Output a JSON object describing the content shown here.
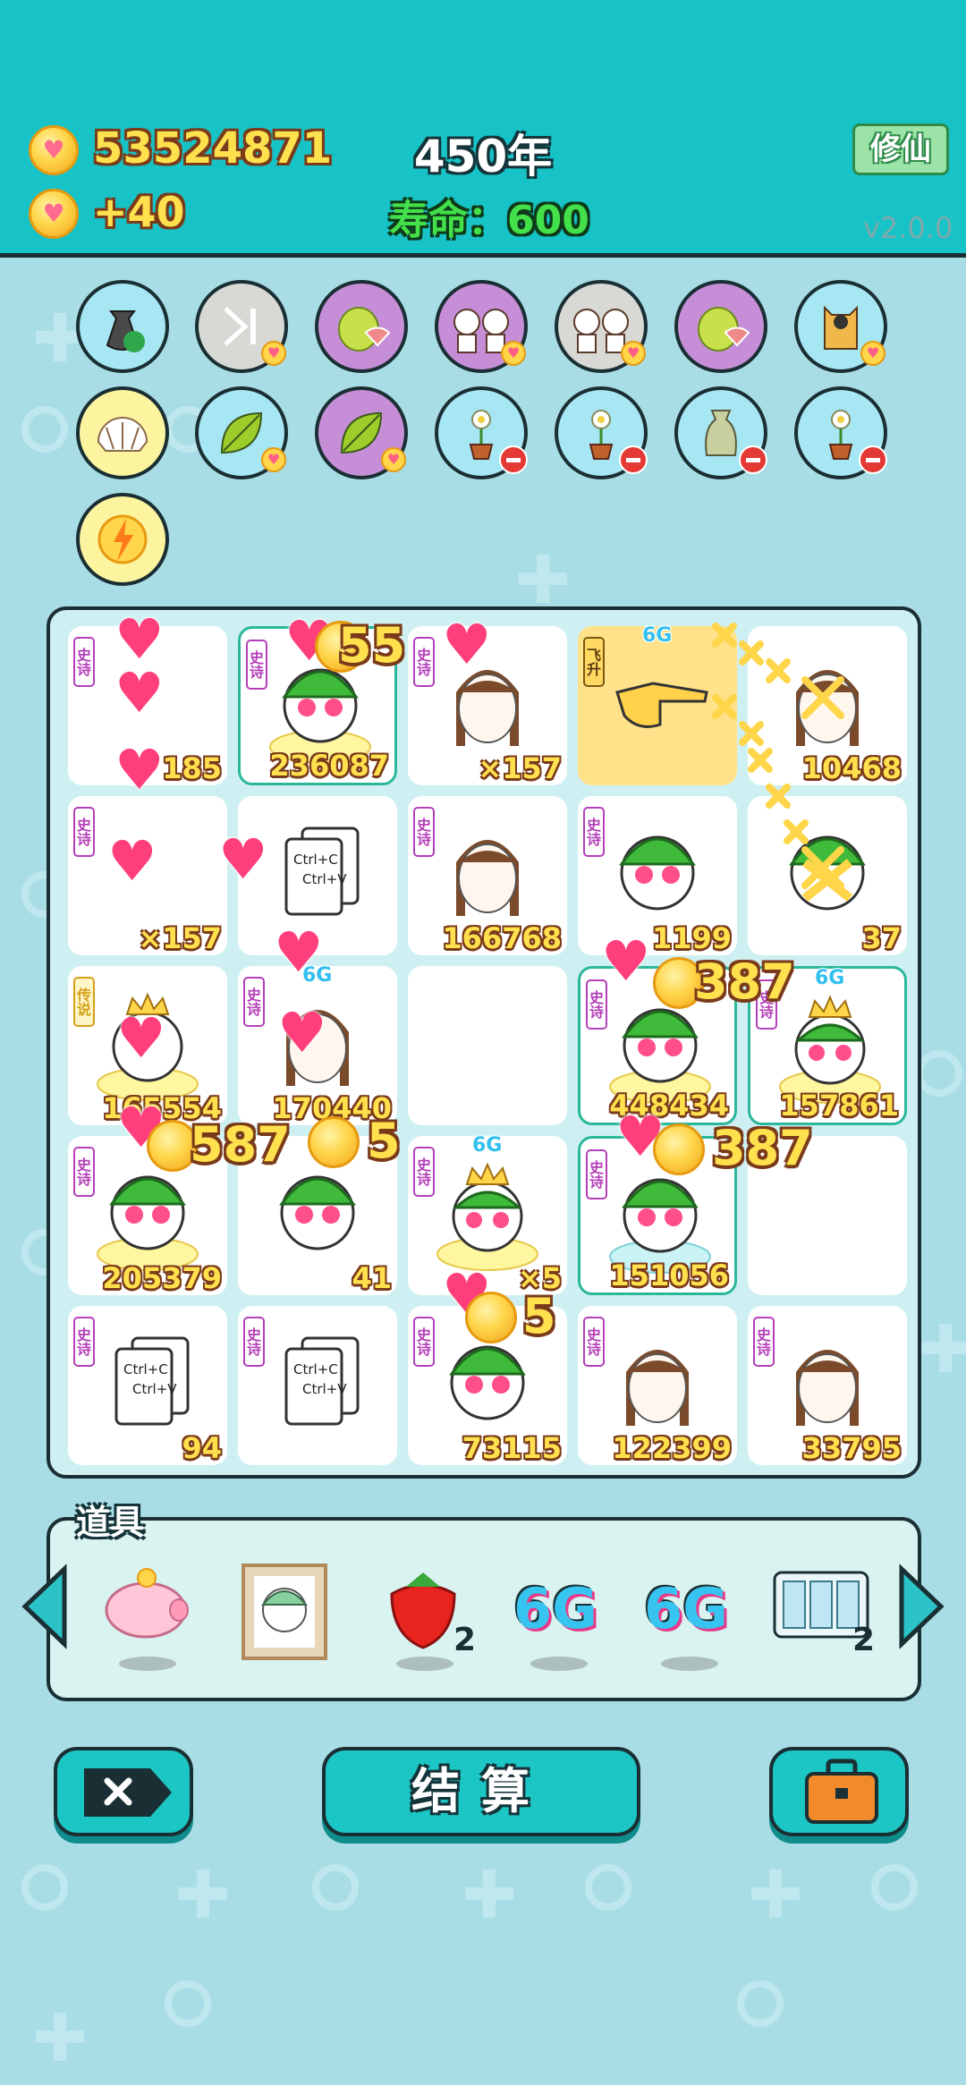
{
  "header": {
    "coins": "53524871",
    "income": "+40",
    "year": "450年",
    "life_label": "寿命：",
    "life_value": "600",
    "cultivate_button": "修仙",
    "version": "v2.0.0"
  },
  "board": {
    "cells": [
      {
        "tag": "史诗",
        "count": "185"
      },
      {
        "tag": "史诗",
        "count": "236087"
      },
      {
        "tag": "史诗",
        "count": "×157"
      },
      {
        "tag": "飞升",
        "badge": "6G"
      },
      {
        "count": "10468"
      },
      {
        "tag": "史诗",
        "count": "×157"
      },
      {
        "count": ""
      },
      {
        "tag": "史诗",
        "count": "166768"
      },
      {
        "tag": "史诗",
        "count": "1199"
      },
      {
        "count": "37"
      },
      {
        "tag": "传说",
        "count": "165554"
      },
      {
        "tag": "史诗",
        "badge": "6G",
        "count": "170440"
      },
      {
        "count": ""
      },
      {
        "tag": "史诗",
        "count": "448434"
      },
      {
        "tag": "史诗",
        "badge": "6G",
        "count": "157861"
      },
      {
        "tag": "史诗",
        "count": "205379"
      },
      {
        "count": "41"
      },
      {
        "tag": "史诗",
        "badge": "6G",
        "count": "×5"
      },
      {
        "tag": "史诗",
        "count": "151056"
      },
      {
        "count": ""
      },
      {
        "tag": "史诗",
        "count": "94"
      },
      {
        "tag": "史诗",
        "count": ""
      },
      {
        "tag": "史诗",
        "count": "73115"
      },
      {
        "tag": "史诗",
        "count": "122399"
      },
      {
        "tag": "史诗",
        "count": "33795"
      }
    ],
    "copy_paste_text": [
      "Ctrl+C",
      "Ctrl+V"
    ],
    "floating_numbers": [
      "55",
      "387",
      "387",
      "587",
      "5",
      "5"
    ]
  },
  "props": {
    "label": "道具",
    "items": [
      {
        "name": "piggy-bank",
        "count": ""
      },
      {
        "name": "portrait",
        "count": ""
      },
      {
        "name": "strawberry",
        "count": "2"
      },
      {
        "name": "6g",
        "text": "6G",
        "count": ""
      },
      {
        "name": "6g",
        "text": "6G",
        "count": ""
      },
      {
        "name": "cards",
        "count": "2"
      }
    ]
  },
  "buttons": {
    "settle": "结算"
  },
  "colors": {
    "header_bg": "#17c3c6",
    "page_bg": "#a9dde6",
    "gold_text": "#ffe04d",
    "life_green": "#44e04a",
    "epic_purple": "#b43fb8"
  }
}
